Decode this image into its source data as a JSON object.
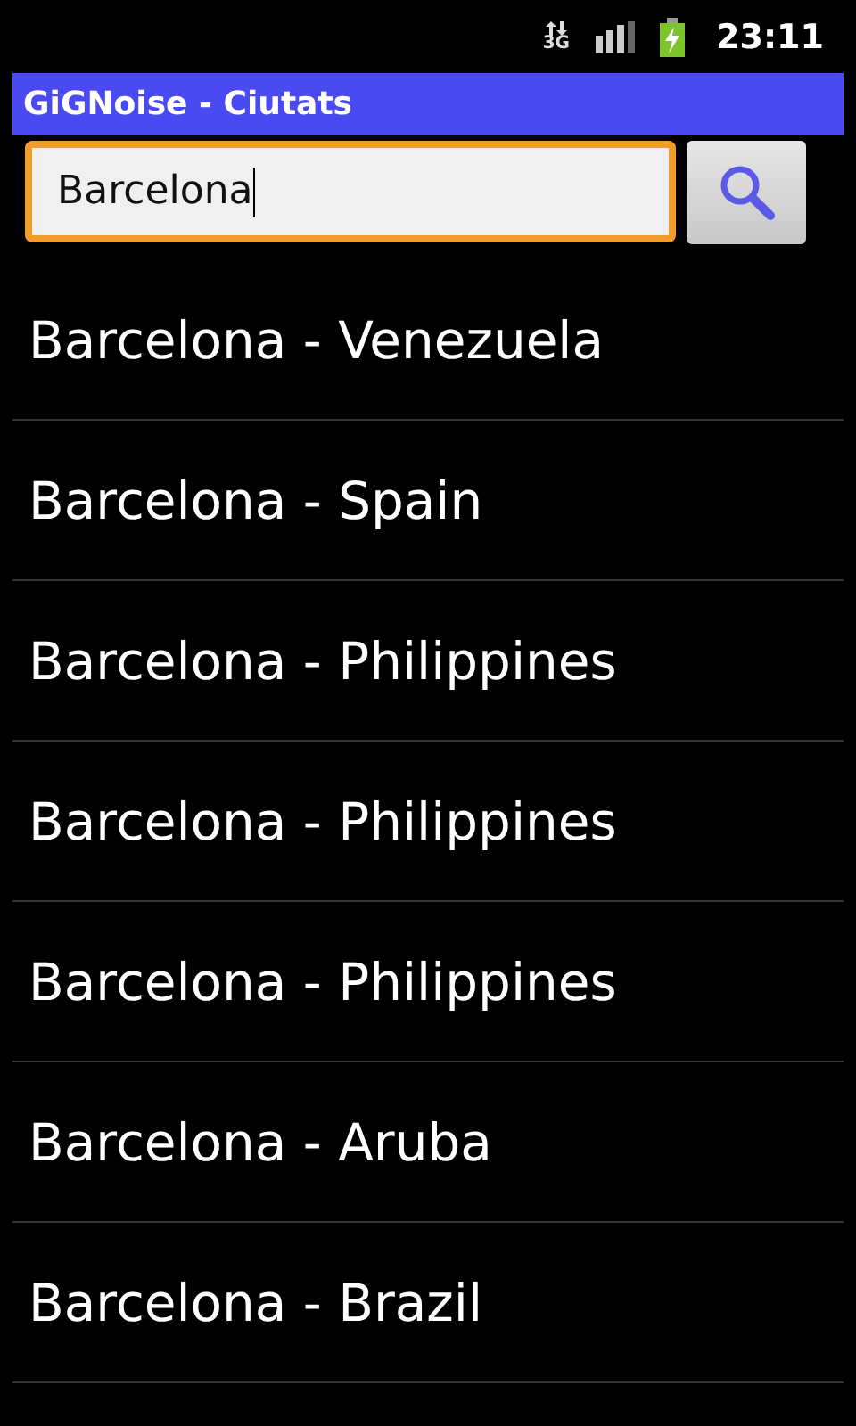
{
  "status_bar": {
    "network_type": "3G",
    "time": "23:11"
  },
  "window": {
    "title": "GiGNoise - Ciutats"
  },
  "search": {
    "value": "Barcelona",
    "focused": true
  },
  "results": [
    {
      "label": "Barcelona - Venezuela"
    },
    {
      "label": "Barcelona - Spain"
    },
    {
      "label": "Barcelona - Philippines"
    },
    {
      "label": "Barcelona - Philippines"
    },
    {
      "label": "Barcelona - Philippines"
    },
    {
      "label": "Barcelona - Aruba"
    },
    {
      "label": "Barcelona - Brazil"
    }
  ]
}
